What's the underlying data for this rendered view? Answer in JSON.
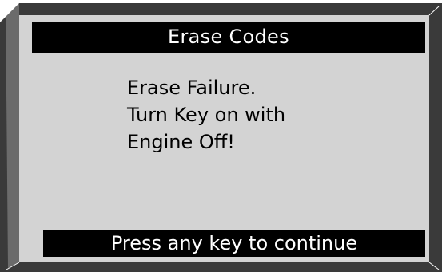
{
  "colors": {
    "bezel": "#3a3a3a",
    "screen_background": "#d3d3d3",
    "bar_background": "#000000",
    "bar_text": "#ffffff",
    "body_text": "#000000"
  },
  "header": {
    "title": "Erase Codes"
  },
  "message": {
    "lines": [
      "Erase Failure.",
      "Turn Key on with",
      "Engine Off!"
    ]
  },
  "footer": {
    "prompt": "Press any key to continue"
  }
}
